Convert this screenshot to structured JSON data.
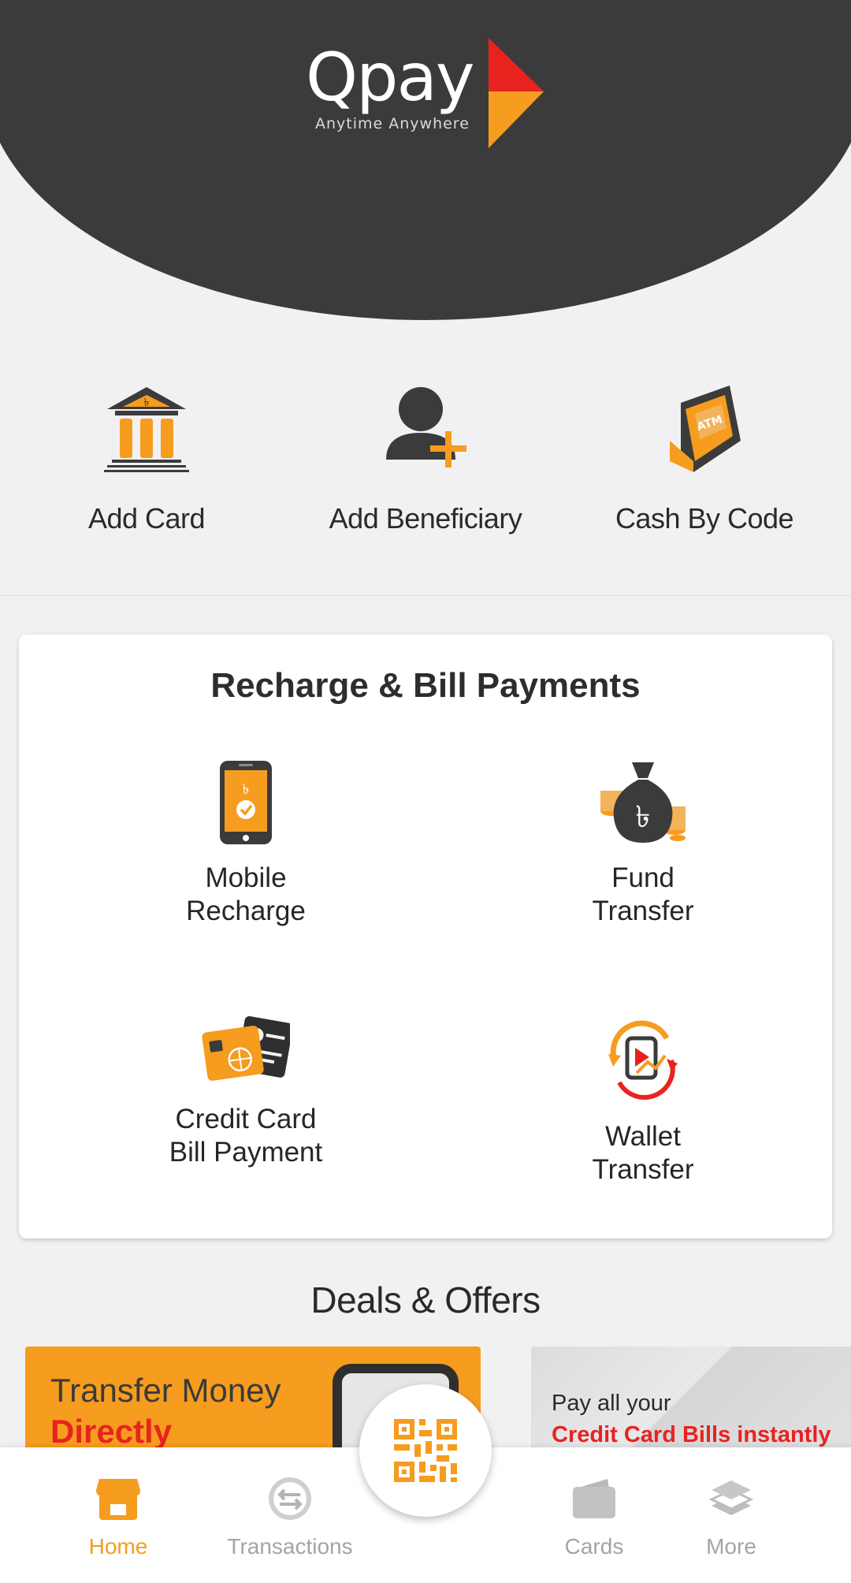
{
  "header": {
    "logo_text": "Qpay",
    "logo_tagline": "Anytime Anywhere"
  },
  "quick_actions": [
    {
      "label": "Add Card",
      "icon": "bank-icon"
    },
    {
      "label": "Add Beneficiary",
      "icon": "add-user-icon"
    },
    {
      "label": "Cash By Code",
      "icon": "atm-icon"
    }
  ],
  "bills": {
    "title": "Recharge & Bill Payments",
    "items": [
      {
        "label": "Mobile\nRecharge",
        "icon": "mobile-recharge-icon"
      },
      {
        "label": "Fund\nTransfer",
        "icon": "money-bag-icon"
      },
      {
        "label": "Credit Card\nBill Payment",
        "icon": "credit-card-icon"
      },
      {
        "label": "Wallet\nTransfer",
        "icon": "wallet-transfer-icon"
      }
    ]
  },
  "deals": {
    "title": "Deals & Offers",
    "banners": [
      {
        "line1": "Transfer Money",
        "line2": "Directly"
      },
      {
        "line1": "Pay all your",
        "line2": "Credit Card  Bills instantly"
      }
    ]
  },
  "nav": {
    "items": [
      {
        "label": "Home",
        "icon": "home-icon",
        "active": true
      },
      {
        "label": "Transactions",
        "icon": "transactions-icon"
      },
      {
        "label": "Cards",
        "icon": "wallet-icon"
      },
      {
        "label": "More",
        "icon": "layers-icon"
      }
    ],
    "center_icon": "qr-code-icon"
  },
  "colors": {
    "accent": "#f69c1e",
    "header_bg": "#3b3b3b",
    "red": "#e8231f"
  }
}
